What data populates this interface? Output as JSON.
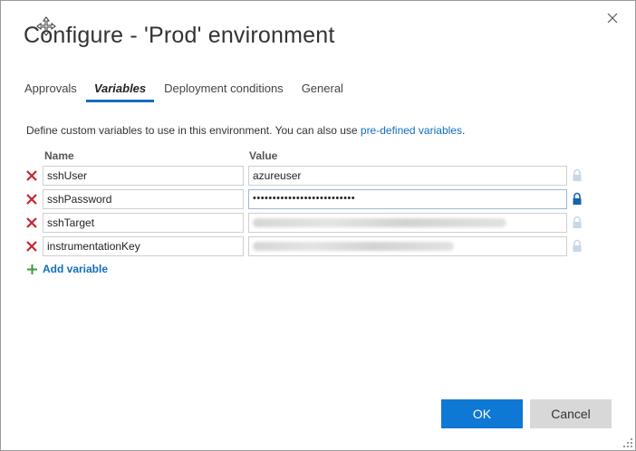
{
  "dialog": {
    "title": "Configure - 'Prod' environment",
    "close_icon": "close-icon",
    "move_icon": "move-icon"
  },
  "tabs": [
    {
      "label": "Approvals",
      "active": false
    },
    {
      "label": "Variables",
      "active": true
    },
    {
      "label": "Deployment conditions",
      "active": false
    },
    {
      "label": "General",
      "active": false
    }
  ],
  "variables": {
    "description": "Define custom variables to use in this environment. You can also use",
    "link_text": "pre-defined variables",
    "description_end": ".",
    "columns": {
      "name": "Name",
      "value": "Value"
    },
    "rows": [
      {
        "name": "sshUser",
        "value": "azureuser",
        "secret": false,
        "blurred": false
      },
      {
        "name": "sshPassword",
        "value": "••••••••••••••••••••••••••",
        "secret": true,
        "blurred": false
      },
      {
        "name": "sshTarget",
        "value": "",
        "secret": false,
        "blurred": true
      },
      {
        "name": "instrumentationKey",
        "value": "",
        "secret": false,
        "blurred": true
      }
    ],
    "add_label": "Add variable"
  },
  "footer": {
    "ok_label": "OK",
    "cancel_label": "Cancel"
  },
  "colors": {
    "accent": "#106ebe",
    "ok_button": "#0f78d4",
    "delete_icon": "#c4262e",
    "add_icon": "#3a9b38"
  }
}
